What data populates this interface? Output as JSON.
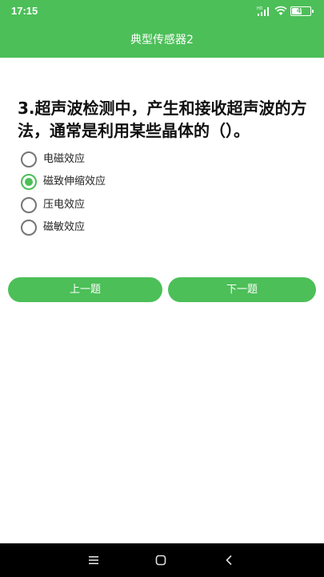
{
  "status_bar": {
    "time": "17:15",
    "signal_icon": "cellular-signal-icon",
    "wifi_icon": "wifi-icon",
    "battery_icon": "battery-icon",
    "battery_level": "49",
    "battery_fraction": 0.49
  },
  "app_bar": {
    "title": "典型传感器2",
    "color": "#4cbf58"
  },
  "question": {
    "text": "3.超声波检测中，产生和接收超声波的方法，通常是利用某些晶体的（）。",
    "options": [
      {
        "label": "电磁效应",
        "selected": false
      },
      {
        "label": "磁致伸缩效应",
        "selected": true
      },
      {
        "label": "压电效应",
        "selected": false
      },
      {
        "label": "磁敏效应",
        "selected": false
      }
    ]
  },
  "buttons": {
    "prev_label": "上一题",
    "next_label": "下一题"
  },
  "system_nav": {
    "menu_icon": "menu-icon",
    "home_icon": "home-icon",
    "back_icon": "back-icon"
  },
  "colors": {
    "accent": "#4cbf58",
    "text": "#111111",
    "nav_bar": "#000000"
  }
}
